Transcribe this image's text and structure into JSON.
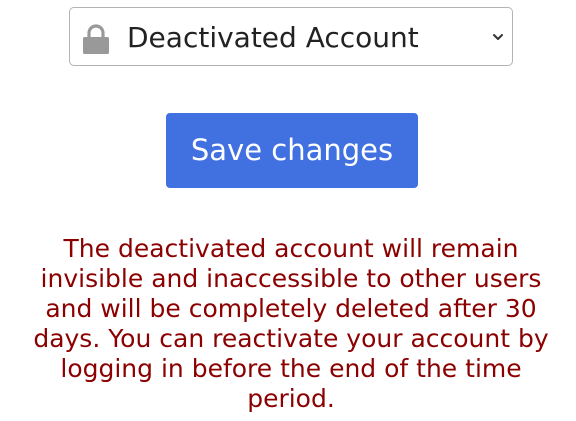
{
  "account_status": {
    "selected_value": "Deactivated Account",
    "icon": "lock-icon",
    "dropdown_icon": "chevron-down-icon"
  },
  "actions": {
    "save_label": "Save changes"
  },
  "notice": {
    "text": "The deactivated account will remain invisible and inaccessible to other users and will be completely deleted after 30 days. You can reactivate your account by logging in before the end of the time period."
  },
  "colors": {
    "button_background": "#4170e0",
    "button_text": "#ffffff",
    "warning_text": "#8b0000",
    "icon_gray": "#999999",
    "border": "#b3b3b3"
  }
}
